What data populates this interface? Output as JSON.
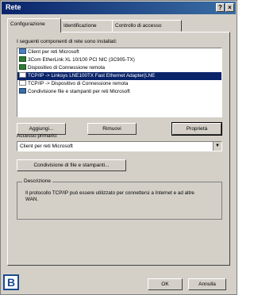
{
  "window": {
    "title": "Rete"
  },
  "tabs": [
    {
      "label": "Configurazione"
    },
    {
      "label": "Identificazione"
    },
    {
      "label": "Controllo di accesso"
    }
  ],
  "components": {
    "label": "I seguenti componenti di rete sono installati:",
    "items": [
      {
        "label": "Client per reti Microsoft",
        "icon": "client-icon"
      },
      {
        "label": "3Com EtherLink XL 10/100 PCI NIC (3C905-TX)",
        "icon": "network-adapter-icon"
      },
      {
        "label": "Dispositivo di Connessione remota",
        "icon": "network-adapter-icon"
      },
      {
        "label": "TCP/IP -> Linksys LNE100TX Fast Ethernet Adapter(LNE",
        "icon": "protocol-icon",
        "selected": true
      },
      {
        "label": "TCP/IP -> Dispositivo di Connessione remota",
        "icon": "protocol-icon"
      },
      {
        "label": "Condivisione file e stampanti per reti Microsoft",
        "icon": "service-icon"
      }
    ]
  },
  "buttons": {
    "add": "Aggiungi...",
    "remove": "Rimuovi",
    "properties": "Proprietà",
    "sharing": "Condivisione di file e stampanti...",
    "ok": "OK",
    "cancel": "Annulla"
  },
  "logon": {
    "label": "Accesso primario:",
    "value": "Client per reti Microsoft"
  },
  "description": {
    "legend": "Descrizione",
    "text": "Il protocollo TCP/IP può essere utilizzato per connettersi a Internet e ad altre WAN."
  },
  "badge": "B",
  "colors": {
    "titlebar": "#0a246a",
    "selection": "#0a246a",
    "badge": "#1a4b8f",
    "face": "#d4d0c8"
  }
}
